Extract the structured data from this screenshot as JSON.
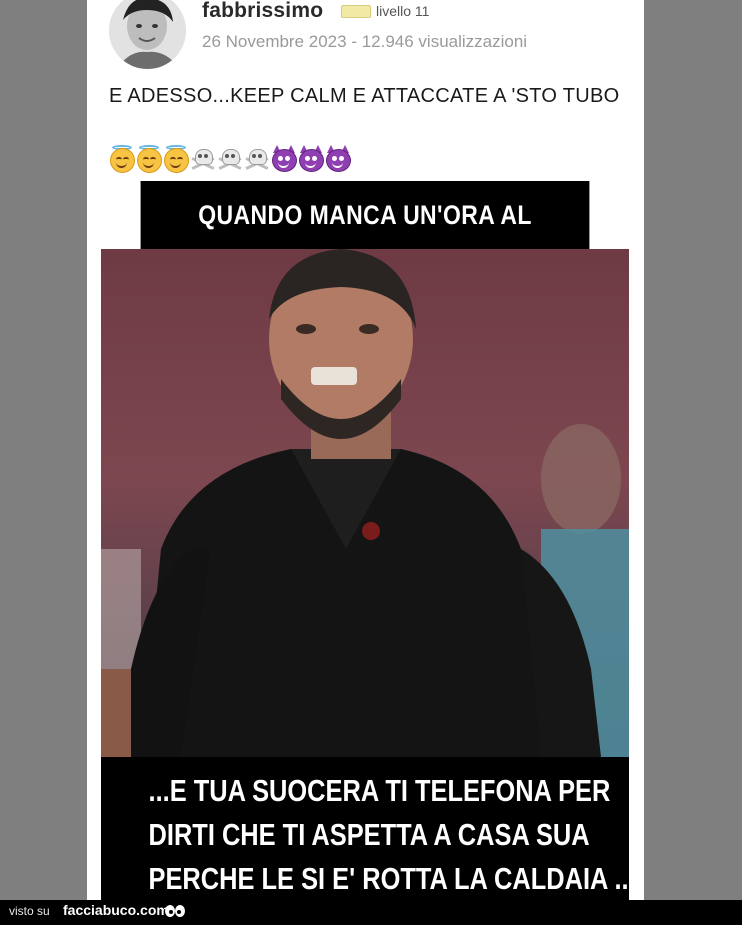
{
  "post": {
    "username": "fabbrissimo",
    "level": "livello 11",
    "meta": "26 Novembre 2023 - 12.946 visualizzazioni",
    "text": "E ADESSO...KEEP CALM E ATTACCATE A 'STO TUBO",
    "emojis": [
      "angel-emoji",
      "angel-emoji",
      "angel-emoji",
      "skull-crossbones-emoji",
      "skull-crossbones-emoji",
      "skull-crossbones-emoji",
      "devil-emoji",
      "devil-emoji",
      "devil-emoji"
    ]
  },
  "meme": {
    "top_caption": "QUANDO MANCA UN'ORA AL PARTITONE...",
    "bottom_caption_lines": [
      "...E TUA SUOCERA TI TELEFONA PER",
      "DIRTI CHE TI ASPETTA A CASA SUA",
      "PERCHE LE SI E' ROTTA LA CALDAIA ...."
    ]
  },
  "footer": {
    "visto": "visto su",
    "brand": "facciabuco.com"
  },
  "colors": {
    "page_background": "#7f7f7f",
    "card_background": "#ffffff",
    "caption_background": "#000000",
    "caption_text": "#ffffff"
  }
}
